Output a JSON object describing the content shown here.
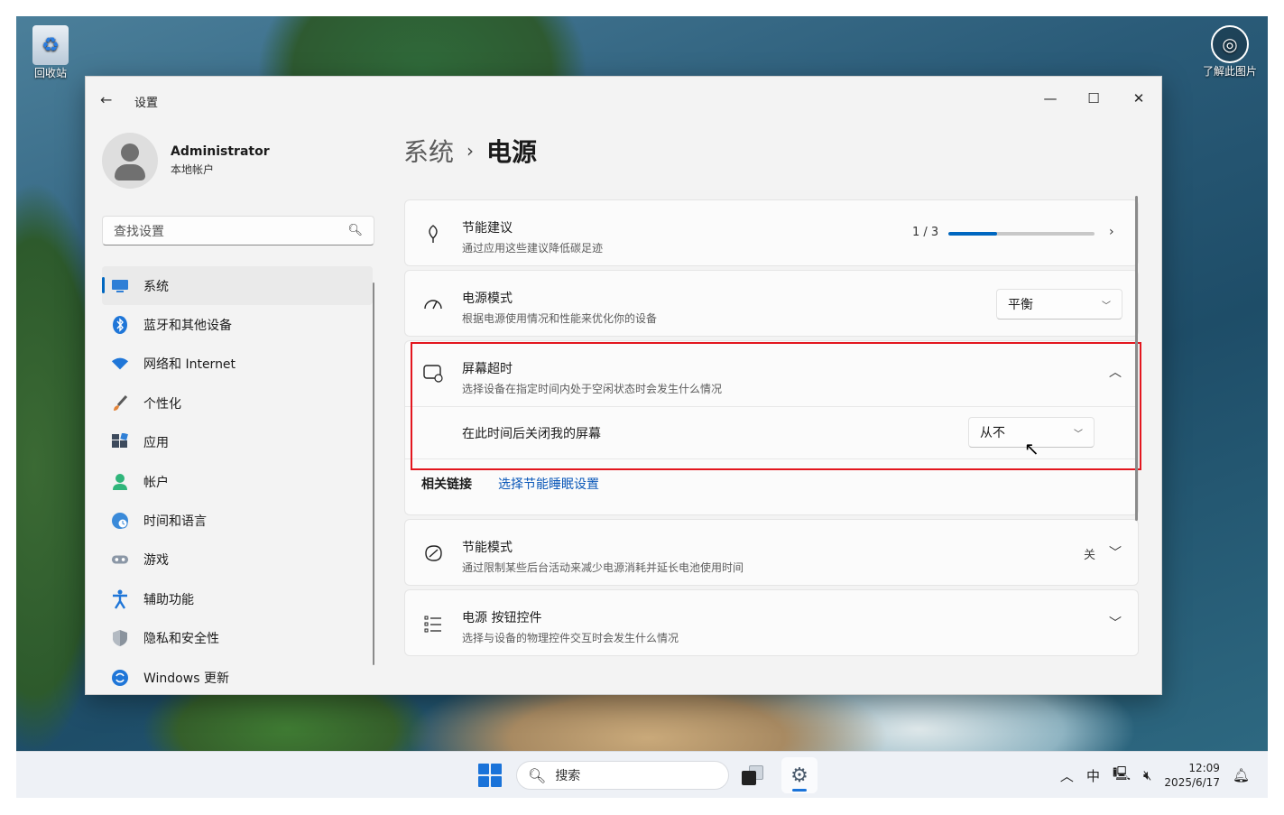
{
  "desktop": {
    "recycle_bin": "回收站",
    "learn_picture": "了解此图片"
  },
  "window": {
    "app_title": "设置",
    "back_icon": "arrow-left-icon",
    "minimize": "—",
    "maximize": "☐",
    "close": "✕"
  },
  "profile": {
    "name": "Administrator",
    "account_type": "本地帐户"
  },
  "search": {
    "placeholder": "查找设置"
  },
  "sidebar": {
    "items": [
      {
        "label": "系统",
        "icon": "monitor-icon",
        "active": true
      },
      {
        "label": "蓝牙和其他设备",
        "icon": "bluetooth-icon"
      },
      {
        "label": "网络和 Internet",
        "icon": "wifi-icon"
      },
      {
        "label": "个性化",
        "icon": "brush-icon"
      },
      {
        "label": "应用",
        "icon": "apps-icon"
      },
      {
        "label": "帐户",
        "icon": "person-icon"
      },
      {
        "label": "时间和语言",
        "icon": "globe-clock-icon"
      },
      {
        "label": "游戏",
        "icon": "gamepad-icon"
      },
      {
        "label": "辅助功能",
        "icon": "accessibility-icon"
      },
      {
        "label": "隐私和安全性",
        "icon": "shield-icon"
      },
      {
        "label": "Windows 更新",
        "icon": "update-icon"
      }
    ]
  },
  "breadcrumb": {
    "parent": "系统",
    "separator": "›",
    "current": "电源"
  },
  "cards": {
    "energy": {
      "title": "节能建议",
      "desc": "通过应用这些建议降低碳足迹",
      "progress_text": "1 / 3",
      "progress_fraction": 0.333
    },
    "power_mode": {
      "title": "电源模式",
      "desc": "根据电源使用情况和性能来优化你的设备",
      "value": "平衡"
    },
    "screen_timeout": {
      "title": "屏幕超时",
      "desc": "选择设备在指定时间内处于空闲状态时会发生什么情况",
      "sub_label": "在此时间后关闭我的屏幕",
      "value": "从不",
      "related_links_label": "相关链接",
      "related_link": "选择节能睡眠设置"
    },
    "saver": {
      "title": "节能模式",
      "desc": "通过限制某些后台活动来减少电源消耗并延长电池使用时间",
      "state": "关"
    },
    "button_controls": {
      "title": "电源 按钮控件",
      "desc": "选择与设备的物理控件交互时会发生什么情况"
    }
  },
  "taskbar": {
    "search_placeholder": "搜索",
    "ime": "中",
    "time": "12:09",
    "date": "2025/6/17"
  },
  "colors": {
    "accent": "#0067c0",
    "highlight": "#e3161e",
    "link": "#0a57b8"
  }
}
